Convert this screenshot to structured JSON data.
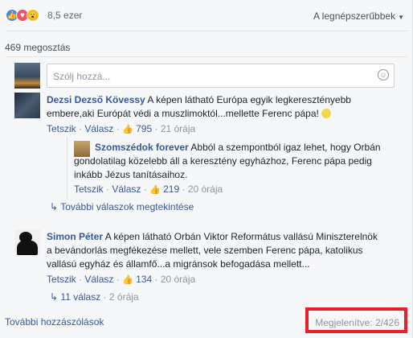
{
  "reactions": {
    "count": "8,5 ezer",
    "icons": [
      "like-icon",
      "love-icon",
      "wow-icon"
    ]
  },
  "sort": {
    "label": "A legnépszerűbbek"
  },
  "shares": "469 megosztás",
  "composer": {
    "placeholder": "Szólj hozzá..."
  },
  "comments": [
    {
      "name": "Dezsi Dezső Kövessy",
      "text_l1": "A képen látható Európa egyik legkeresztényebb",
      "text_l2": "embere,aki Európát védi a muszlimoktól...mellette Ferenc pápa!",
      "like_label": "Tetszik",
      "reply_label": "Válasz",
      "likes": "795",
      "time": "21 órája"
    },
    {
      "name": "Szomszédok forever",
      "text_l1": "Abból a szempontból igaz lehet, hogy Orbán",
      "text_l2": "gondolatilag közelebb áll a keresztény egyházhoz, Ferenc pápa pedig",
      "text_l3": "inkább Jézus tanításaihoz.",
      "like_label": "Tetszik",
      "reply_label": "Válasz",
      "likes": "219",
      "time": "20 órája"
    },
    {
      "name": "Simon Péter",
      "text_l1": "A képen látható Orbán Viktor Református vallású Miniszterelnök",
      "text_l2": "a bevándorlás megfékezése mellett, vele szemben Ferenc pápa, katolikus",
      "text_l3": "vallású egyház és államfő...a migránsok befogadása mellett...",
      "like_label": "Tetszik",
      "reply_label": "Válasz",
      "likes": "134",
      "time": "20 órája"
    }
  ],
  "more_replies": "További válaszok megtekintése",
  "replies_count": "11 válasz",
  "replies_time": "2 órája",
  "more_comments": "További hozzászólások",
  "shown_count": "Megjelenítve: 2/426"
}
